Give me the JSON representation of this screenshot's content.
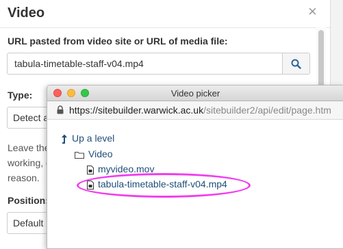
{
  "dialog": {
    "title": "Video",
    "close_glyph": "×",
    "url_label": "URL pasted from video site or URL of media file:",
    "url_value": "tabula-timetable-staff-v04.mp4",
    "type_label": "Type:",
    "type_value": "Detect a",
    "help_lines": [
      "Leave the",
      "working, c",
      "reason."
    ],
    "position_label": "Position:",
    "position_value": "Default"
  },
  "picker": {
    "title": "Video picker",
    "url_host": "https://sitebuilder.warwick.ac.uk",
    "url_path": "/sitebuilder2/api/edit/page.htm",
    "up_level": "Up a level",
    "folder": "Video",
    "files": [
      "myvideo.mov",
      "tabula-timetable-staff-v04.mp4"
    ]
  },
  "colors": {
    "link": "#1f4e79",
    "highlight": "#f23cf0",
    "search_icon": "#2a6496"
  }
}
